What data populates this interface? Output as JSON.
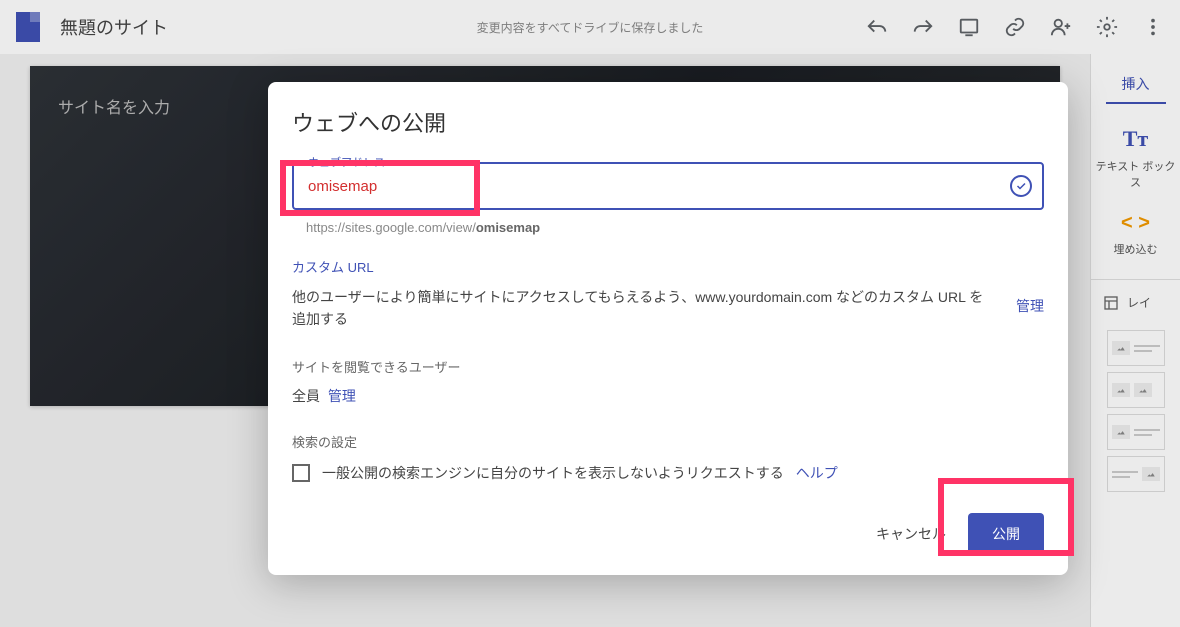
{
  "topbar": {
    "title": "無題のサイト",
    "save_status": "変更内容をすべてドライブに保存しました"
  },
  "canvas": {
    "placeholder": "サイト名を入力"
  },
  "sidepanel": {
    "tab": "挿入",
    "textbox": "テキスト ボックス",
    "embed": "埋め込む",
    "layout": "レイ"
  },
  "dialog": {
    "title": "ウェブへの公開",
    "field_label": "ウェブアドレス",
    "field_value": "omisemap",
    "url_prefix": "https://sites.google.com/view/",
    "url_slug": "omisemap",
    "custom_url_label": "カスタム URL",
    "custom_url_desc": "他のユーザーにより簡単にサイトにアクセスしてもらえるよう、www.yourdomain.com などのカスタム URL を追加する",
    "manage": "管理",
    "viewer_label": "サイトを閲覧できるユーザー",
    "viewer_value": "全員",
    "viewer_manage": "管理",
    "search_label": "検索の設定",
    "search_checkbox": "一般公開の検索エンジンに自分のサイトを表示しないようリクエストする",
    "help": "ヘルプ",
    "cancel": "キャンセル",
    "publish": "公開"
  }
}
